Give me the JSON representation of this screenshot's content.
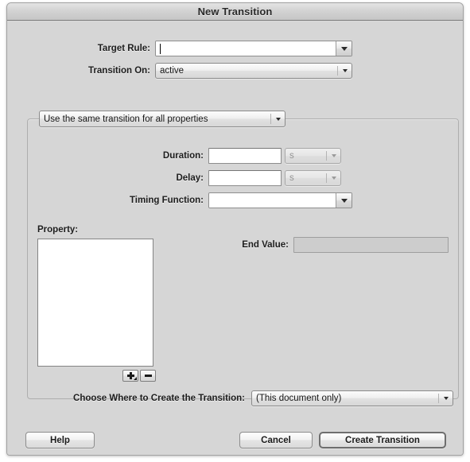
{
  "window": {
    "title": "New Transition"
  },
  "form": {
    "target_rule": {
      "label": "Target Rule:",
      "value": "",
      "icon": "chevron-down-icon"
    },
    "transition_on": {
      "label": "Transition On:",
      "value": "active",
      "icon": "chevron-down-icon"
    }
  },
  "group": {
    "mode_popup": {
      "value": "Use the same transition for all properties",
      "icon": "chevron-down-icon"
    },
    "duration": {
      "label": "Duration:",
      "value": "",
      "unit": "s",
      "unit_icon": "chevron-down-icon"
    },
    "delay": {
      "label": "Delay:",
      "value": "",
      "unit": "s",
      "unit_icon": "chevron-down-icon"
    },
    "timing_function": {
      "label": "Timing Function:",
      "value": "",
      "icon": "chevron-down-icon"
    },
    "property": {
      "label": "Property:",
      "items": [],
      "add_icon": "plus-icon",
      "remove_icon": "minus-icon"
    },
    "end_value": {
      "label": "End Value:",
      "value": ""
    }
  },
  "destination": {
    "label": "Choose Where to Create the Transition:",
    "value": "(This document only)",
    "icon": "chevron-down-icon"
  },
  "buttons": {
    "help": "Help",
    "cancel": "Cancel",
    "create": "Create Transition"
  },
  "colors": {
    "window_bg": "#d6d6d6",
    "focus_ring": "#6c98ca",
    "field_bg": "#ffffff",
    "disabled_bg": "#cdcdcd",
    "text": "#1d1d1d"
  }
}
